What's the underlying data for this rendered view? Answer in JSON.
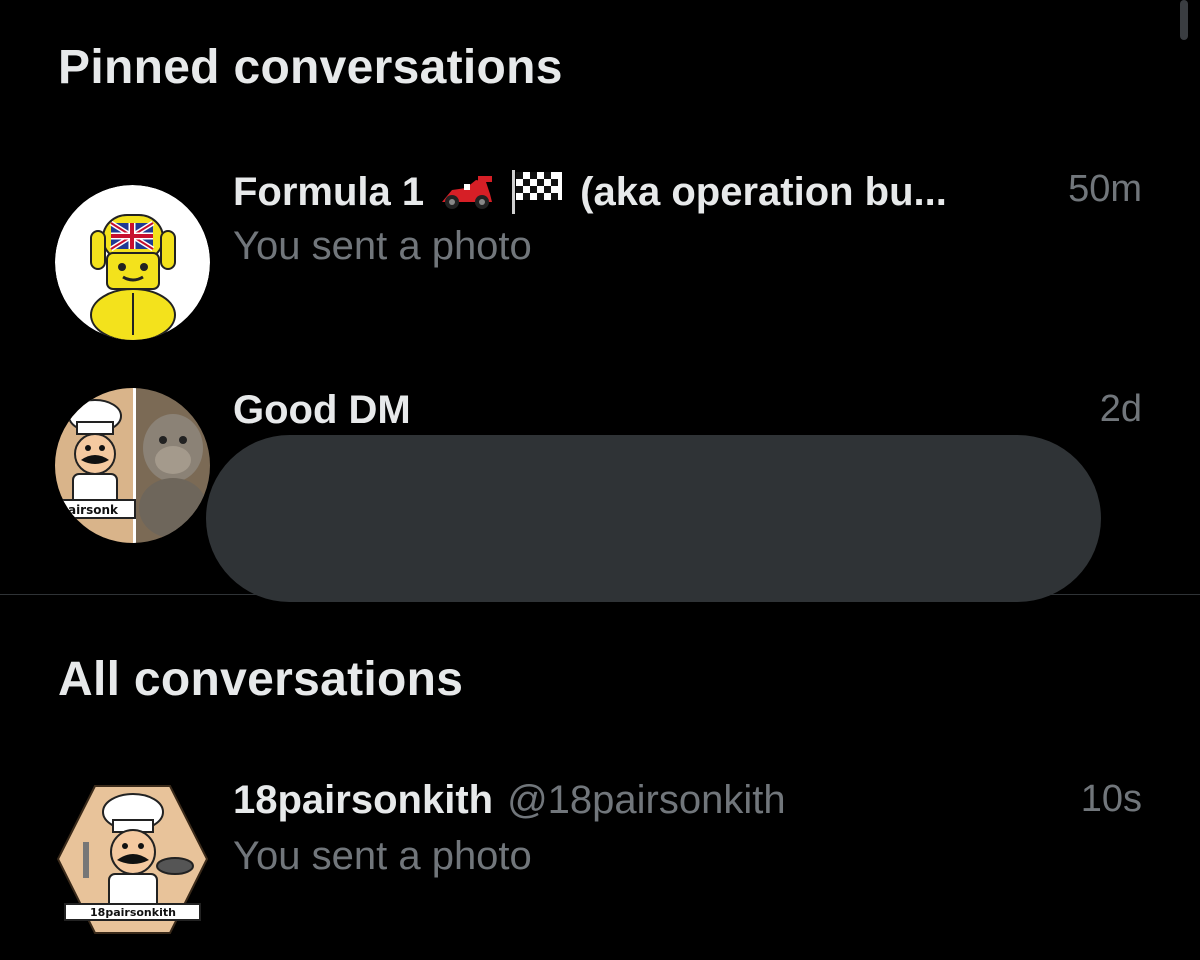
{
  "pinned": {
    "title": "Pinned conversations",
    "items": [
      {
        "name": "Formula 1",
        "name_suffix": "(aka operation bu...",
        "emojis": [
          "race-car-icon",
          "checkered-flag-icon"
        ],
        "time": "50m",
        "preview": "You sent a photo",
        "avatar": "yellow-character-avatar"
      },
      {
        "name": "Good DM",
        "time": "2d",
        "preview": "",
        "preview_redacted": true,
        "avatar": "group-avatar"
      }
    ]
  },
  "all": {
    "title": "All conversations",
    "items": [
      {
        "name": "18pairsonkith",
        "handle": "@18pairsonkith",
        "time": "10s",
        "preview": "You sent a photo",
        "avatar": "chef-logo-avatar",
        "avatar_text": "18pairsonkith"
      }
    ]
  },
  "colors": {
    "background": "#000000",
    "primary_text": "#e7e9ea",
    "secondary_text": "#71767b",
    "redaction": "#2f3336",
    "divider": "#2f3336"
  }
}
